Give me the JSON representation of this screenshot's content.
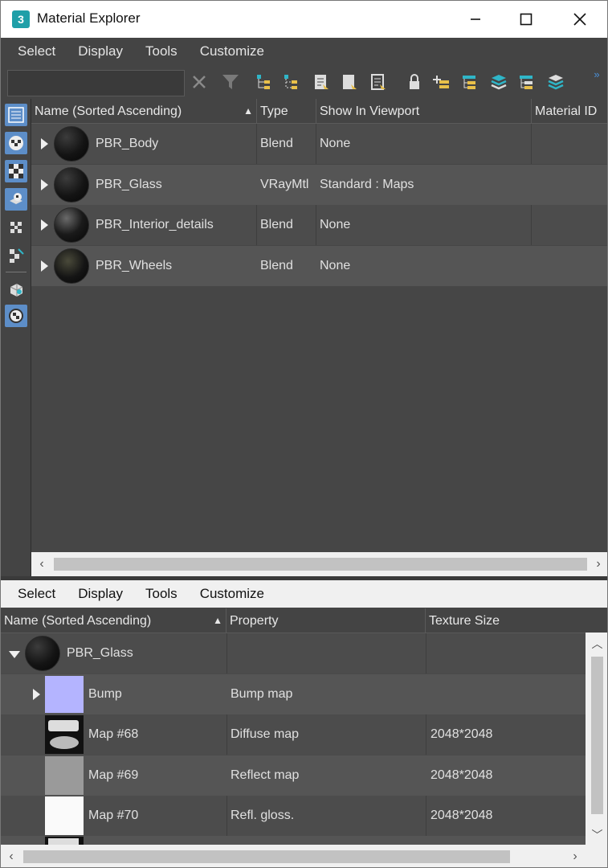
{
  "window": {
    "title": "Material Explorer",
    "app_icon_text": "3"
  },
  "top_menu": [
    "Select",
    "Display",
    "Tools",
    "Customize"
  ],
  "search": {
    "placeholder": ""
  },
  "top_grid": {
    "columns": [
      "Name (Sorted Ascending)",
      "Type",
      "Show In Viewport",
      "Material ID"
    ],
    "rows": [
      {
        "name": "PBR_Body",
        "type": "Blend",
        "viewport": "None",
        "material_id": ""
      },
      {
        "name": "PBR_Glass",
        "type": "VRayMtl",
        "viewport": "Standard : Maps",
        "material_id": ""
      },
      {
        "name": "PBR_Interior_details",
        "type": "Blend",
        "viewport": "None",
        "material_id": ""
      },
      {
        "name": "PBR_Wheels",
        "type": "Blend",
        "viewport": "None",
        "material_id": ""
      }
    ]
  },
  "bottom_menu": [
    "Select",
    "Display",
    "Tools",
    "Customize"
  ],
  "bottom_grid": {
    "columns": [
      "Name (Sorted Ascending)",
      "Property",
      "Texture Size"
    ],
    "parent": {
      "name": "PBR_Glass"
    },
    "rows": [
      {
        "name": "Bump",
        "property": "Bump map",
        "texture_size": ""
      },
      {
        "name": "Map #68",
        "property": "Diffuse map",
        "texture_size": "2048*2048"
      },
      {
        "name": "Map #69",
        "property": "Reflect map",
        "texture_size": "2048*2048"
      },
      {
        "name": "Map #70",
        "property": "Refl. gloss.",
        "texture_size": "2048*2048"
      }
    ]
  },
  "colors": {
    "accent": "#5d8ec8",
    "toolbar_icon": "#2fb6c8",
    "toolbar_icon_alt": "#e8c04a",
    "bump_swatch": "#b4b4ff"
  },
  "icons": [
    "close-icon",
    "minimize-icon",
    "maximize-icon",
    "clear-search-icon",
    "filter-icon",
    "lock-icon",
    "chevron-more-icon"
  ]
}
